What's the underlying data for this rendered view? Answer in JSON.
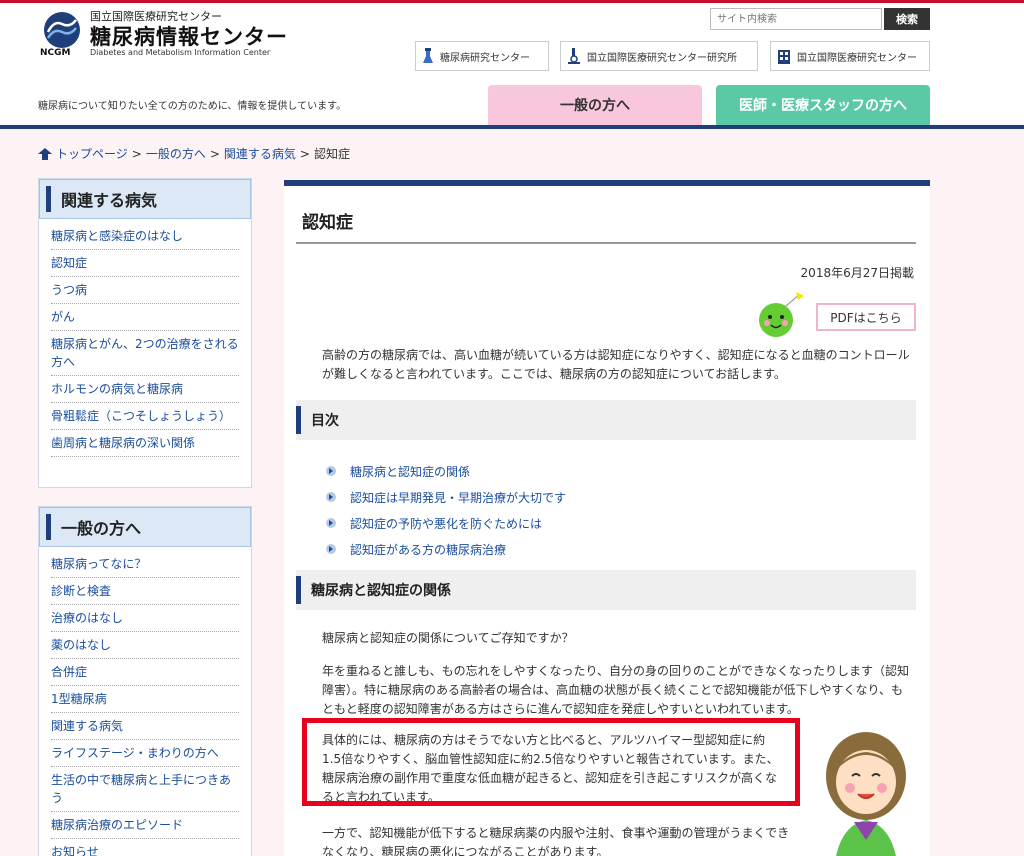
{
  "header": {
    "org_label": "国立国際医療研究センター",
    "site_name": "糖尿病情報センター",
    "site_name_en": "Diabetes and Metabolism Information Center",
    "logo_abbr": "NCGM",
    "tagline": "糖尿病について知りたい全ての方のために、情報を提供しています。",
    "search_placeholder": "サイト内検索",
    "search_button": "検索",
    "links": [
      "糖尿病研究センター",
      "国立国際医療研究センター研究所",
      "国立国際医療研究センター"
    ],
    "tabs": {
      "general": "一般の方へ",
      "medical": "医師・医療スタッフの方へ"
    }
  },
  "breadcrumb": {
    "home": "トップページ",
    "level1": "一般の方へ",
    "level2": "関連する病気",
    "current": "認知症",
    "sep": ">"
  },
  "sidebar": {
    "related": {
      "title": "関連する病気",
      "items": [
        "糖尿病と感染症のはなし",
        "認知症",
        "うつ病",
        "がん",
        "糖尿病とがん、2つの治療をされる方へ",
        "ホルモンの病気と糖尿病",
        "骨粗鬆症（こつそしょうしょう）",
        "歯周病と糖尿病の深い関係"
      ]
    },
    "general": {
      "title": "一般の方へ",
      "items": [
        "糖尿病ってなに？",
        "診断と検査",
        "治療のはなし",
        "薬のはなし",
        "合併症",
        "1型糖尿病",
        "関連する病気",
        "ライフステージ・まわりの方へ",
        "生活の中で糖尿病と上手につきあう",
        "糖尿病治療のエピソード",
        "お知らせ"
      ]
    }
  },
  "main": {
    "title": "認知症",
    "date": "2018年6月27日掲載",
    "pdf_button": "PDFはこちら",
    "intro": "高齢の方の糖尿病では、高い血糖が続いている方は認知症になりやすく、認知症になると血糖のコントロールが難しくなると言われています。ここでは、糖尿病の方の認知症についてお話します。",
    "toc_title": "目次",
    "toc": [
      "糖尿病と認知症の関係",
      "認知症は早期発見・早期治療が大切です",
      "認知症の予防や悪化を防ぐためには",
      "認知症がある方の糖尿病治療"
    ],
    "section1_title": "糖尿病と認知症の関係",
    "p1": "糖尿病と認知症の関係についてご存知ですか？",
    "p2": "年を重ねると誰しも、もの忘れをしやすくなったり、自分の身の回りのことができなくなったりします（認知障害）。特に糖尿病のある高齢者の場合は、高血糖の状態が長く続くことで認知機能が低下しやすくなり、もともと軽度の認知障害がある方はさらに進んで認知症を発症しやすいといわれています。",
    "p3": "具体的には、糖尿病の方はそうでない方と比べると、アルツハイマー型認知症に約1.5倍なりやすく、脳血管性認知症に約2.5倍なりやすいと報告されています。また、糖尿病治療の副作用で重度な低血糖が起きると、認知症を引き起こすリスクが高くなると言われています。",
    "p4": "一方で、認知機能が低下すると糖尿病薬の内服や注射、食事や運動の管理がうまくできなくなり、糖尿病の悪化につながることがあります。"
  },
  "colors": {
    "brand_navy": "#1f3f7a",
    "highlight_red": "#e8001c",
    "tab_pink": "#f8c7dd",
    "tab_green": "#5bc8a6",
    "link_blue": "#1a4c9c"
  },
  "icons": [
    "ncgm-logo-icon",
    "flask-icon",
    "microscope-icon",
    "building-icon",
    "home-arrow-icon",
    "mascot-icon",
    "grandmother-illustration"
  ]
}
